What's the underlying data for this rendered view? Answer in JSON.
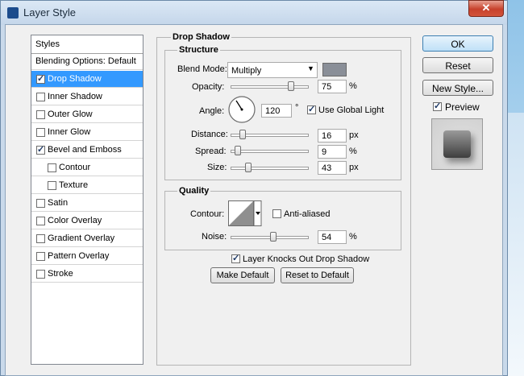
{
  "window": {
    "title": "Layer Style",
    "close_icon": "close-icon"
  },
  "styles_panel": {
    "header": "Styles",
    "items": [
      {
        "label": "Blending Options: Default",
        "checkbox": false,
        "checked": false,
        "selected": false,
        "indent": 0
      },
      {
        "label": "Drop Shadow",
        "checkbox": true,
        "checked": true,
        "selected": true,
        "indent": 0
      },
      {
        "label": "Inner Shadow",
        "checkbox": true,
        "checked": false,
        "selected": false,
        "indent": 0
      },
      {
        "label": "Outer Glow",
        "checkbox": true,
        "checked": false,
        "selected": false,
        "indent": 0
      },
      {
        "label": "Inner Glow",
        "checkbox": true,
        "checked": false,
        "selected": false,
        "indent": 0
      },
      {
        "label": "Bevel and Emboss",
        "checkbox": true,
        "checked": true,
        "selected": false,
        "indent": 0
      },
      {
        "label": "Contour",
        "checkbox": true,
        "checked": false,
        "selected": false,
        "indent": 1
      },
      {
        "label": "Texture",
        "checkbox": true,
        "checked": false,
        "selected": false,
        "indent": 1
      },
      {
        "label": "Satin",
        "checkbox": true,
        "checked": false,
        "selected": false,
        "indent": 0
      },
      {
        "label": "Color Overlay",
        "checkbox": true,
        "checked": false,
        "selected": false,
        "indent": 0
      },
      {
        "label": "Gradient Overlay",
        "checkbox": true,
        "checked": false,
        "selected": false,
        "indent": 0
      },
      {
        "label": "Pattern Overlay",
        "checkbox": true,
        "checked": false,
        "selected": false,
        "indent": 0
      },
      {
        "label": "Stroke",
        "checkbox": true,
        "checked": false,
        "selected": false,
        "indent": 0
      }
    ]
  },
  "drop_shadow": {
    "title": "Drop Shadow",
    "structure": {
      "title": "Structure",
      "blend_mode_label": "Blend Mode:",
      "blend_mode_value": "Multiply",
      "shadow_color": "#8a8f98",
      "opacity_label": "Opacity:",
      "opacity_value": "75",
      "opacity_unit": "%",
      "angle_label": "Angle:",
      "angle_value": "120",
      "angle_unit": "°",
      "use_global_light_label": "Use Global Light",
      "use_global_light_checked": true,
      "distance_label": "Distance:",
      "distance_value": "16",
      "distance_unit": "px",
      "spread_label": "Spread:",
      "spread_value": "9",
      "spread_unit": "%",
      "size_label": "Size:",
      "size_value": "43",
      "size_unit": "px"
    },
    "quality": {
      "title": "Quality",
      "contour_label": "Contour:",
      "anti_aliased_label": "Anti-aliased",
      "anti_aliased_checked": false,
      "noise_label": "Noise:",
      "noise_value": "54",
      "noise_unit": "%"
    },
    "layer_knocks_out_label": "Layer Knocks Out Drop Shadow",
    "layer_knocks_out_checked": true,
    "make_default_label": "Make Default",
    "reset_to_default_label": "Reset to Default"
  },
  "buttons": {
    "ok_label": "OK",
    "reset_label": "Reset",
    "new_style_label": "New Style...",
    "preview_label": "Preview",
    "preview_checked": true
  }
}
